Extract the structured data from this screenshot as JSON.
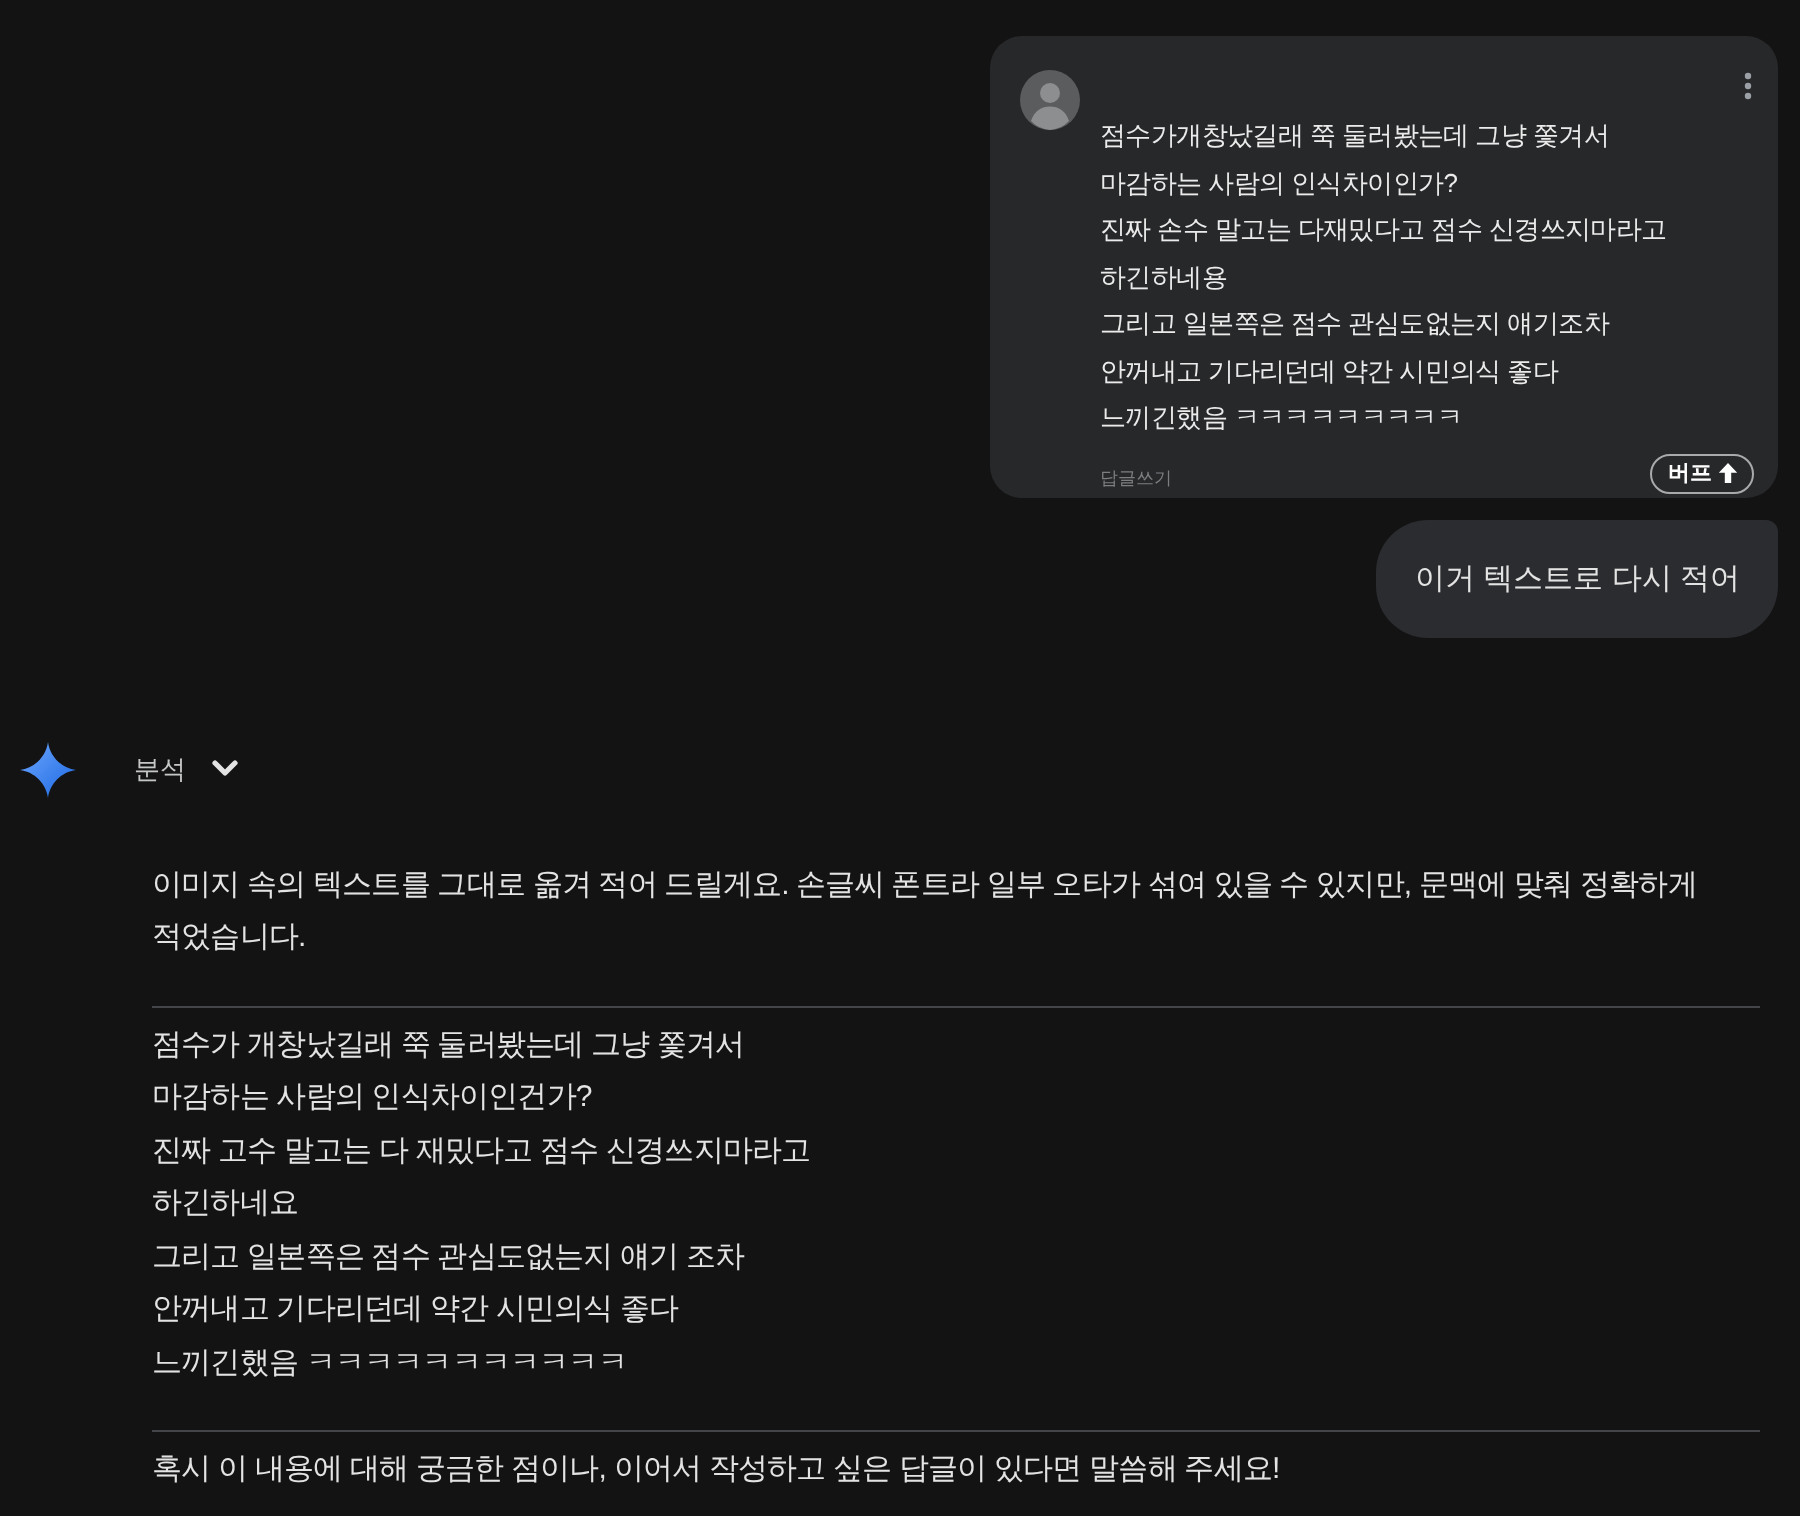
{
  "shared_post": {
    "lines": [
      "점수가개창났길래 쭉 둘러봤는데 그냥 쫓겨서",
      "마감하는 사람의 인식차이인가?",
      "진짜 손수 말고는 다재밌다고 점수 신경쓰지마라고",
      "하긴하네용",
      "그리고 일본쪽은 점수 관심도없는지 얘기조차",
      "안꺼내고 기다리던데 약간 시민의식 좋다",
      "느끼긴했음 ㅋㅋㅋㅋㅋㅋㅋㅋㅋ"
    ],
    "reply_link": "답글쓰기",
    "boost_button": {
      "label": "버프"
    }
  },
  "user_message": {
    "text": "이거 텍스트로 다시 적어"
  },
  "response": {
    "analysis_toggle": {
      "label": "분석",
      "expanded": false
    },
    "intro": "이미지 속의 텍스트를 그대로 옮겨 적어 드릴게요. 손글씨 폰트라 일부 오타가 섞여 있을 수 있지만, 문맥에 맞춰 정확하게 적었습니다.",
    "transcription": [
      "점수가 개창났길래 쭉 둘러봤는데 그냥 쫓겨서",
      "마감하는 사람의 인식차이인건가?",
      "진짜 고수 말고는 다 재밌다고 점수 신경쓰지마라고",
      "하긴하네요",
      "그리고 일본쪽은 점수 관심도없는지 얘기 조차",
      "안꺼내고 기다리던데 약간 시민의식 좋다",
      "느끼긴했음 ㅋㅋㅋㅋㅋㅋㅋㅋㅋㅋㅋ"
    ],
    "closing": "혹시 이 내용에 대해 궁금한 점이나, 이어서 작성하고 싶은 답글이 있다면 말씀해 주세요!"
  }
}
